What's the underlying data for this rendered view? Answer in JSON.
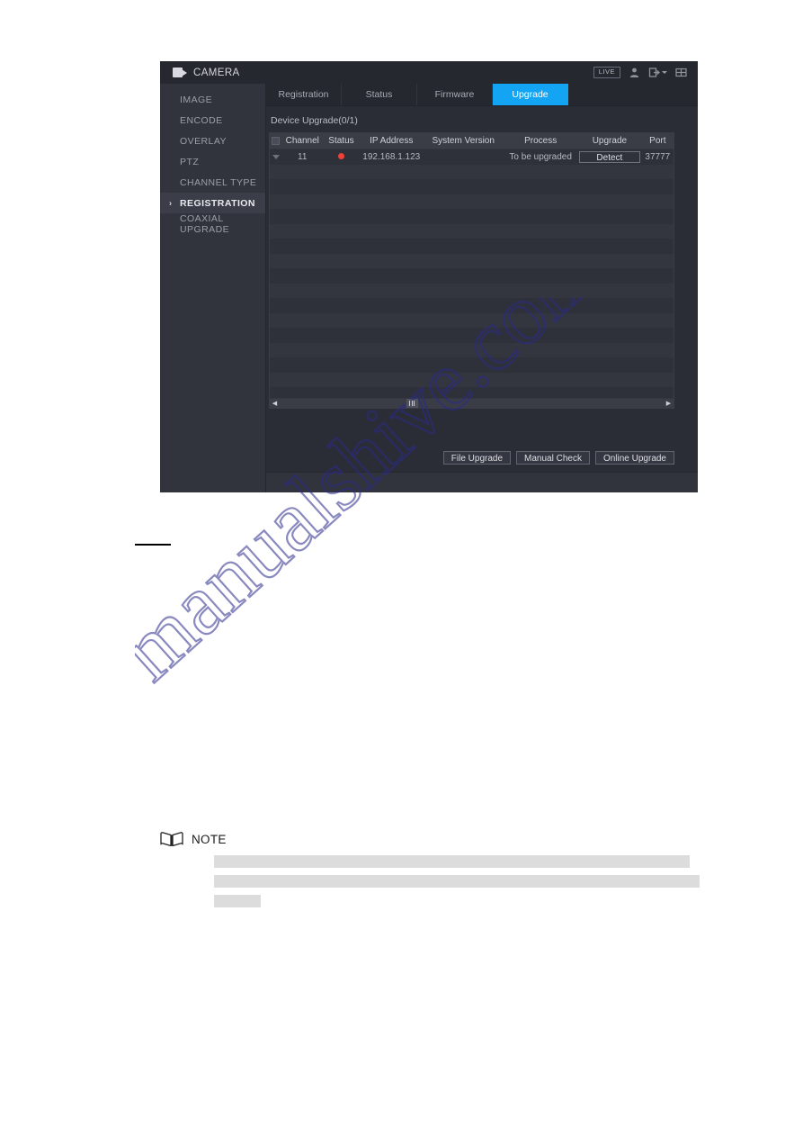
{
  "window": {
    "title": "CAMERA",
    "title_icon": "video-camera-icon",
    "live_badge": "LIVE",
    "icons": [
      "user-icon",
      "logout-icon",
      "grid-apps-icon"
    ]
  },
  "sidebar": {
    "items": [
      {
        "label": "IMAGE",
        "active": false
      },
      {
        "label": "ENCODE",
        "active": false
      },
      {
        "label": "OVERLAY",
        "active": false
      },
      {
        "label": "PTZ",
        "active": false
      },
      {
        "label": "CHANNEL TYPE",
        "active": false
      },
      {
        "label": "REGISTRATION",
        "active": true
      },
      {
        "label": "COAXIAL UPGRADE",
        "active": false
      }
    ]
  },
  "tabs": [
    {
      "label": "Registration",
      "active": false
    },
    {
      "label": "Status",
      "active": false
    },
    {
      "label": "Firmware",
      "active": false
    },
    {
      "label": "Upgrade",
      "active": true
    }
  ],
  "panel": {
    "section_label": "Device Upgrade(0/1)",
    "columns": [
      "Channel",
      "Status",
      "IP Address",
      "System Version",
      "Process",
      "Upgrade",
      "Port"
    ],
    "rows": [
      {
        "channel": "11",
        "status": "red-dot",
        "ip_address": "192.168.1.123",
        "system_version": "",
        "process": "To be upgraded",
        "upgrade_label": "Detect",
        "port": "37777"
      }
    ],
    "empty_row_count": 17,
    "buttons": [
      {
        "label": "File Upgrade"
      },
      {
        "label": "Manual Check"
      },
      {
        "label": "Online Upgrade"
      }
    ]
  },
  "note": {
    "icon": "book-icon",
    "title": "NOTE",
    "bar_widths": [
      "529px",
      "540px",
      "52px"
    ]
  },
  "colors": {
    "accent": "#13a4f4",
    "status_red": "#ef4237",
    "window_bg": "#2b2d36",
    "sidebar_bg": "#32343d"
  },
  "watermark": {
    "text": "manualshive.com"
  }
}
